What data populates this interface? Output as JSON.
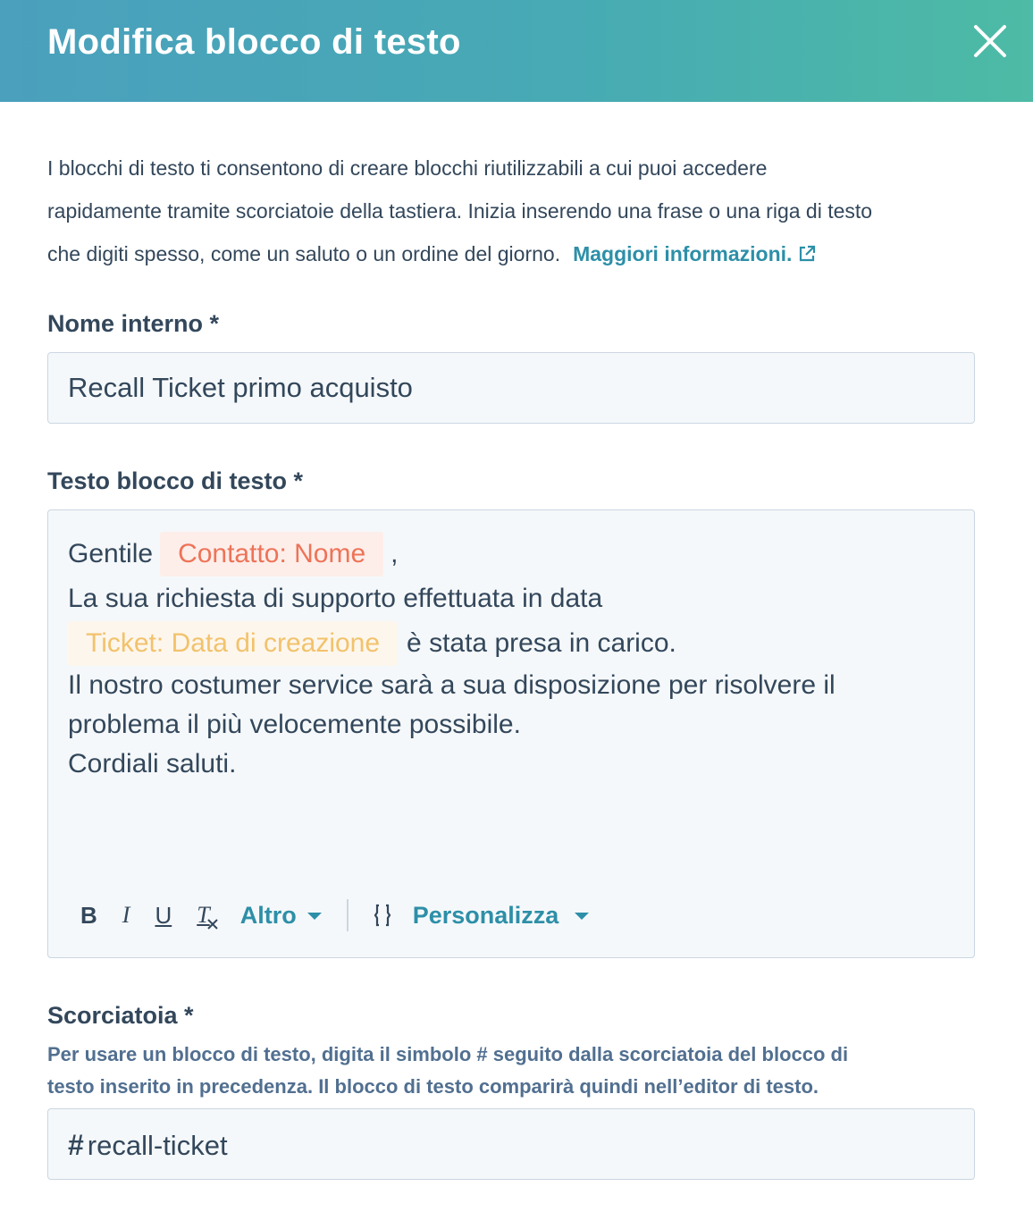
{
  "header": {
    "title": "Modifica blocco di testo",
    "close_icon": "close-icon"
  },
  "intro": {
    "line1": "I blocchi di testo ti consentono di creare blocchi riutilizzabili a cui puoi accedere",
    "line2": "rapidamente tramite scorciatoie della tastiera. Inizia inserendo una frase o una riga di testo",
    "line3": "che digiti spesso, come un saluto o un ordine del giorno.",
    "link": "Maggiori informazioni.",
    "link_icon": "external-link-icon"
  },
  "internal_name": {
    "label": "Nome interno *",
    "value": "Recall Ticket primo acquisto"
  },
  "body": {
    "label": "Testo blocco di testo *",
    "greeting": "Gentile",
    "token_contact": "Contatto: Nome",
    "comma": ",",
    "line2": "La sua richiesta di supporto effettuata in data",
    "token_ticket": "Ticket: Data di creazione",
    "line3_after": "è stata presa in carico.",
    "line4": "Il nostro costumer service sarà a sua disposizione per risolvere il",
    "line5": "problema il più velocemente possibile.",
    "line6": "Cordiali saluti."
  },
  "toolbar": {
    "bold": "B",
    "italic": "I",
    "underline": "U",
    "clear_format": "T",
    "more": "Altro",
    "personalize_icon": "personalize-token-icon",
    "personalize": "Personalizza"
  },
  "shortcut": {
    "label": "Scorciatoia *",
    "hint_line1": "Per usare un blocco di testo, digita il simbolo # seguito dalla scorciatoia del blocco di",
    "hint_line2": "testo inserito in precedenza. Il blocco di testo comparirà quindi nell’editor di testo.",
    "prefix": "#",
    "value": "recall-ticket"
  },
  "colors": {
    "header_gradient_start": "#4aa0bd",
    "header_gradient_end": "#4dbba5",
    "link": "#2d8fa8",
    "token_orange_text": "#ee7357",
    "token_yellow_text": "#f2c26c"
  }
}
